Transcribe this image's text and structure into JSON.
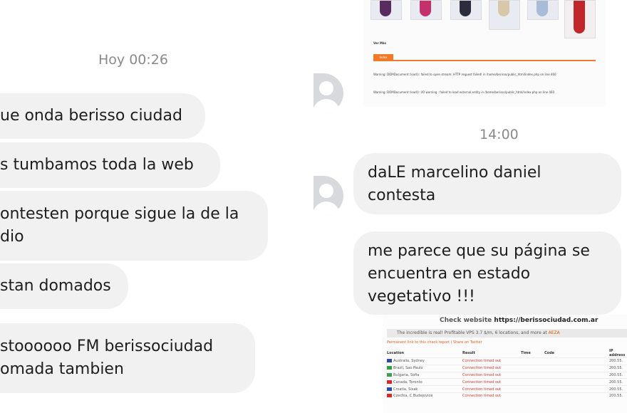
{
  "left_chat": {
    "timestamp": "Hoy 00:26",
    "messages": [
      {
        "lines": [
          "ue onda berisso ciudad"
        ]
      },
      {
        "lines": [
          "s tumbamos toda la web"
        ]
      },
      {
        "lines": [
          "ontesten porque sigue la de la",
          "dio"
        ]
      },
      {
        "lines": [
          "stan domados"
        ]
      },
      {
        "lines": [
          "stoooooo FM berissociudad",
          "omada tambien"
        ]
      }
    ]
  },
  "right_chat": {
    "embedded_page": {
      "ver_mas": "Ver Más",
      "button": "Index",
      "warning1": "Warning: DOMDocument::load(): failed to open stream: HTTP request failed! in /home/berisso/public_html/index.php on line 460",
      "warning2": "Warning: DOMDocument::load(): I/O warning : failed to load external entity in /home/berisso/public_html/index.php on line 460"
    },
    "timestamp": "14:00",
    "messages": [
      {
        "lines": [
          "daLE marcelino daniel",
          "contesta"
        ]
      },
      {
        "lines": [
          "me parece que su página se",
          "encuentra en estado",
          "vegetativo !!!"
        ]
      }
    ],
    "check_website": {
      "title_prefix": "Check website",
      "url": "https://berissociudad.com.ar",
      "banner_text": "The incredible is real! Profitable VPS 3.7 $/m, 6 locations, and more at",
      "banner_link": "AEZA",
      "permanent_link": "Permanent link to this check report",
      "share": "Share on Twitter",
      "headers": [
        "Location",
        "Result",
        "Time",
        "Code",
        "IP address"
      ],
      "rows": [
        {
          "location": "Australia, Sydney",
          "result": "Connection timed out",
          "ip": "200.55.",
          "flag_color": "#2b4aa0"
        },
        {
          "location": "Brazil, Sao Paulo",
          "result": "Connection timed out",
          "ip": "200.55.",
          "flag_color": "#2f9e3f"
        },
        {
          "location": "Bulgaria, Sofia",
          "result": "Connection timed out",
          "ip": "200.55.",
          "flag_color": "#3f9d4a"
        },
        {
          "location": "Canada, Toronto",
          "result": "Connection timed out",
          "ip": "200.55.",
          "flag_color": "#d8262b"
        },
        {
          "location": "Croatia, Sisak",
          "result": "Connection timed out",
          "ip": "200.55.",
          "flag_color": "#2a4bb0"
        },
        {
          "location": "Czechia, C.Budejovice",
          "result": "Connection timed out",
          "ip": "200.55.",
          "flag_color": "#d8262b"
        }
      ]
    }
  }
}
